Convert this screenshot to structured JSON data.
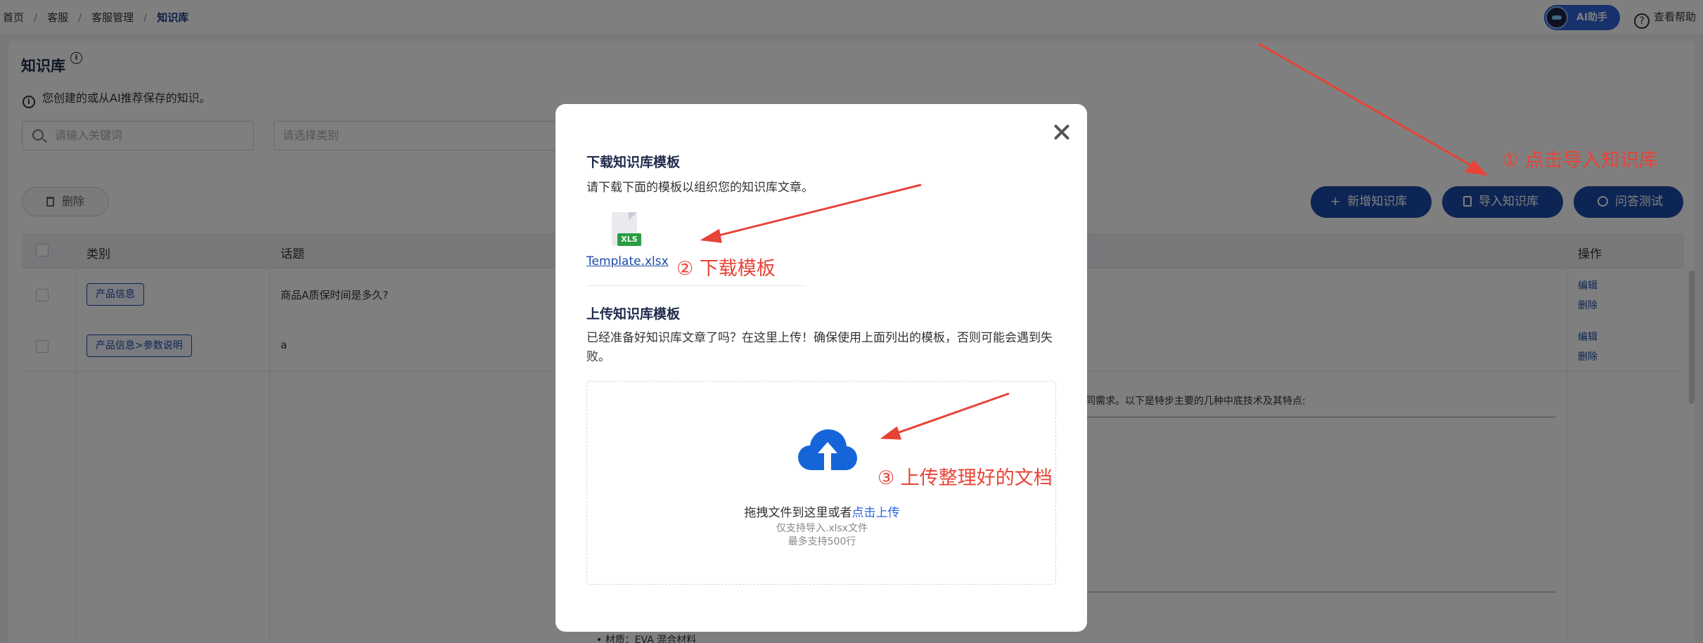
{
  "breadcrumb": [
    "首页",
    "客服",
    "客服管理",
    "知识库"
  ],
  "header": {
    "ai_assistant": "AI助手",
    "help": "查看帮助"
  },
  "page": {
    "title": "知识库",
    "hint": "您创建的或从AI推荐保存的知识。",
    "search_placeholder": "请输入关键词",
    "category_placeholder": "请选择类别",
    "delete_label": "删除",
    "add_label": "新增知识库",
    "import_label": "导入知识库",
    "qa_label": "问答测试"
  },
  "table": {
    "headers": {
      "category": "类别",
      "topic": "话题",
      "ops": "操作"
    },
    "rows": [
      {
        "category": "产品信息",
        "topic": "商品A质保时间是多久?",
        "edit": "编辑",
        "delete": "删除"
      },
      {
        "category": "产品信息>参数说明",
        "topic": "a",
        "edit": "编辑",
        "delete": "删除"
      }
    ],
    "content_excerpt": "同需求。以下是特步主要的几种中底技术及其特点:",
    "footer_bullet": "• 材质：EVA 混合材料"
  },
  "modal": {
    "download_title": "下载知识库模板",
    "download_desc": "请下载下面的模板以组织您的知识库文章。",
    "file_badge": "XLS",
    "template_file": "Template.xlsx",
    "upload_title": "上传知识库模板",
    "upload_desc": "已经准备好知识库文章了吗？在这里上传！确保使用上面列出的模板，否则可能会遇到失败。",
    "drop_text": "拖拽文件到这里或者",
    "drop_link": "点击上传",
    "drop_hint1": "仅支持导入.xlsx文件",
    "drop_hint2": "最多支持500行"
  },
  "annotations": {
    "step1": "① 点击导入知识库",
    "step2": "② 下载模板",
    "step3": "③ 上传整理好的文档",
    "color": "#e84336"
  },
  "colors": {
    "primary": "#1a4aa8",
    "link": "#2c63d9",
    "xls_green": "#2a9d44",
    "cloud": "#1565d8"
  }
}
